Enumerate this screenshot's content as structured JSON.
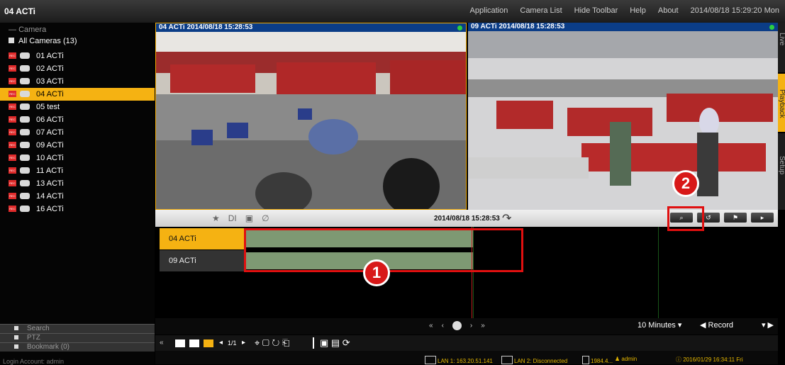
{
  "app": {
    "title": "04 ACTi"
  },
  "menu": [
    "Application",
    "Camera List",
    "Hide Toolbar",
    "Help",
    "About",
    "2014/08/18 15:29:20 Mon"
  ],
  "sidebar": {
    "section_label": "Camera",
    "all_cameras": "All Cameras (13)",
    "cameras": [
      "01  ACTi",
      "02  ACTi",
      "03  ACTi",
      "04  ACTi",
      "05  test",
      "06  ACTi",
      "07  ACTi",
      "09  ACTi",
      "10  ACTi",
      "11  ACTi",
      "13  ACTi",
      "14  ACTi",
      "16  ACTi"
    ],
    "selected_index": 3,
    "rec_label": "REC",
    "panels": [
      "Search",
      "PTZ",
      "Bookmark (0)"
    ],
    "login": "Login Account: admin"
  },
  "videos": [
    {
      "title": "04 ACTi  2014/08/18 15:28:53"
    },
    {
      "title": "09 ACTi  2014/08/18 15:28:53"
    }
  ],
  "right_tabs": [
    "Live",
    "Playback",
    "Setup"
  ],
  "controls": {
    "event_icons": [
      "★",
      "DI",
      "▣",
      "∅"
    ],
    "timestamp": "2014/08/18 15:28:53",
    "rotate": "↷",
    "buttons": [
      "⌕",
      "↺",
      "⚑",
      "▸"
    ]
  },
  "timeline": {
    "tracks": [
      "04 ACTi",
      "09 ACTi"
    ],
    "active_track": 0
  },
  "annotations": [
    "1",
    "2"
  ],
  "playback": {
    "controls": [
      "«",
      "‹",
      "",
      "›",
      "»"
    ],
    "interval": "10 Minutes",
    "interval_arrow": "▾",
    "mode_prev": "◀",
    "mode": "Record",
    "mode_arrow": "▾ ▶"
  },
  "layoutbar": {
    "collapse": "«",
    "page": "1/1",
    "prev": "◂",
    "next": "▸",
    "tools": "⌖ ▢ ↻ ⎗",
    "snapshots": "▣ ▤ ⟳"
  },
  "status": {
    "lan1": "LAN 1: 163.20.51.141",
    "lan2": "LAN 2: Disconnected",
    "storage": "1984.4...",
    "user": "admin",
    "datetime": "2016/01/29 16:34:11 Fri"
  },
  "colors": {
    "accent": "#f5b212",
    "rec": "#e02b2b",
    "video_bar": "#0b3d87",
    "record_bar": "#7e9973",
    "highlight": "#e01010"
  }
}
